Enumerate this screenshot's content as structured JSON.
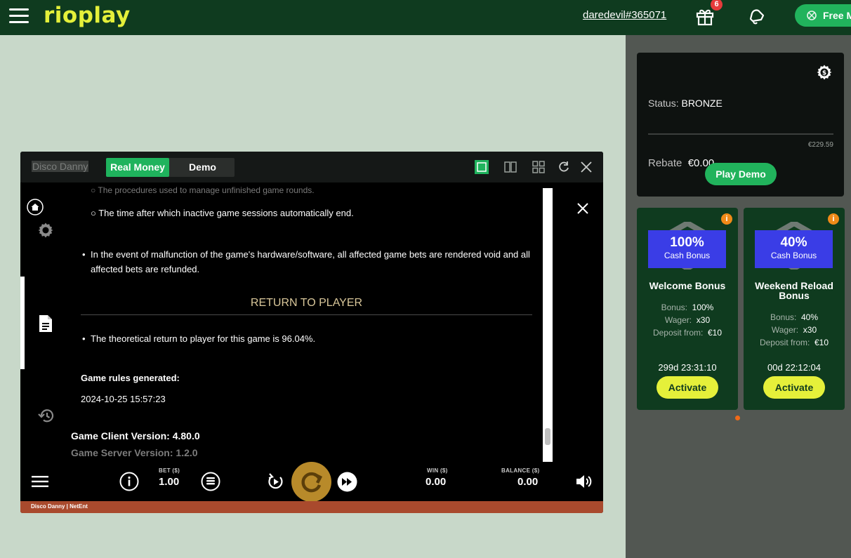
{
  "brand": {
    "logo_text": "rioplay"
  },
  "header": {
    "username": "daredevil#365071",
    "gift_badge": "6",
    "free_button_label": "Free M"
  },
  "status_card": {
    "status_label": "Status:",
    "status_value": "BRONZE",
    "progress_fraction": 0.0,
    "rebate_target": "€229.59",
    "rebate_label": "Rebate",
    "rebate_value": "€0.00",
    "play_demo_label": "Play Demo"
  },
  "bonuses": [
    {
      "pct": "100%",
      "tag": "Cash Bonus",
      "name": "Welcome Bonus",
      "bonus_label": "Bonus:",
      "bonus_value": "100%",
      "wager_label": "Wager:",
      "wager_value": "x30",
      "deposit_label": "Deposit from:",
      "deposit_value": "€10",
      "timer": "299d  23:31:10",
      "activate_label": "Activate"
    },
    {
      "pct": "40%",
      "tag": "Cash Bonus",
      "name": "Weekend Reload Bonus",
      "bonus_label": "Bonus:",
      "bonus_value": "40%",
      "wager_label": "Wager:",
      "wager_value": "x30",
      "deposit_label": "Deposit from:",
      "deposit_value": "€10",
      "timer": "00d  22:12:04",
      "activate_label": "Activate"
    }
  ],
  "game": {
    "title": "Disco Danny",
    "tab_real": "Real Money",
    "tab_demo": "Demo",
    "rules": {
      "item_procedures": "The procedures used to manage unfinished game rounds.",
      "item_inactive": "The time after which inactive game sessions automatically end.",
      "malfunction": "In the event of malfunction of the game's hardware/software, all affected game bets are rendered void and all affected bets are refunded.",
      "rtp_heading": "RETURN TO PLAYER",
      "rtp_text": "The theoretical return to player for this game is 96.04%.",
      "generated_label": "Game rules generated:",
      "generated_value": "2024-10-25 15:57:23",
      "client_version": "Game Client Version: 4.80.0",
      "server_version": "Game Server Version: 1.2.0"
    },
    "controls": {
      "bet_label": "BET ($)",
      "bet_value": "1.00",
      "win_label": "WIN ($)",
      "win_value": "0.00",
      "balance_label": "BALANCE ($)",
      "balance_value": "0.00"
    },
    "footer": "Disco Danny  |  NetEnt"
  },
  "colors": {
    "header_bg": "#0f3b1f",
    "accent_green": "#21b35c",
    "logo_yellow": "#e4f03a",
    "bonus_blue": "#3a3de6",
    "spin_gold": "#b88a2a",
    "footer_orange": "#a94a2d"
  }
}
